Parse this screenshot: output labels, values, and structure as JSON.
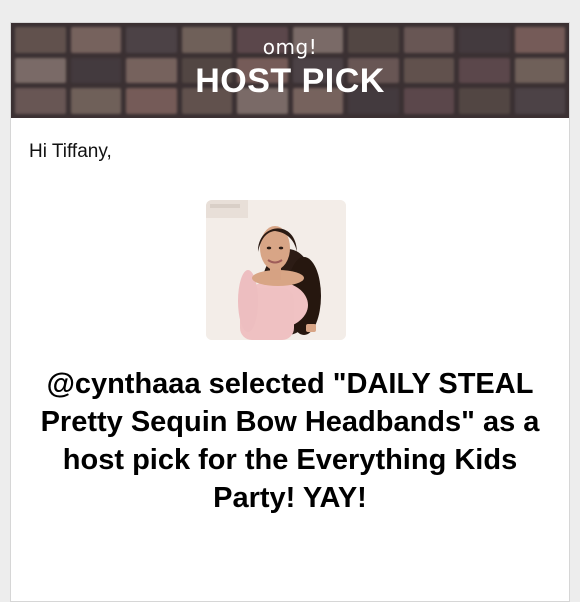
{
  "banner": {
    "subtitle": "omg!",
    "title": "HOST PICK"
  },
  "greeting": "Hi Tiffany,",
  "message": "@cynthaaa selected \"DAILY STEAL Pretty Sequin Bow Headbands\" as a host pick for the Everything Kids Party! YAY!",
  "colors": {
    "banner_overlay": "#4b4040",
    "text": "#000000",
    "card": "#ffffff",
    "page": "#ededed"
  }
}
